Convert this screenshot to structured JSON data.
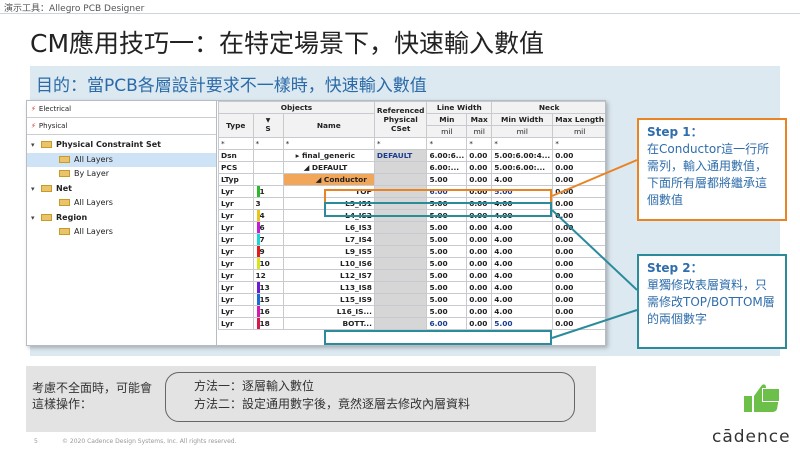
{
  "window": {
    "title": "演示工具：Allegro PCB Designer"
  },
  "slide": {
    "title": "CM應用技巧一：在特定場景下，快速輸入數值",
    "subtitle": "目的：當PCB各層設計要求不一樣時，快速輸入數值"
  },
  "tool": {
    "worksheet_tabs": [
      {
        "label": "Electrical",
        "icon": "electrical-icon"
      },
      {
        "label": "Physical",
        "icon": "physical-icon"
      }
    ],
    "tree": [
      {
        "label": "Physical Constraint Set",
        "level": 0,
        "expanded": true,
        "bold": true,
        "selected": false
      },
      {
        "label": "All Layers",
        "level": 1,
        "expanded": false,
        "bold": false,
        "selected": true
      },
      {
        "label": "By Layer",
        "level": 1,
        "expanded": false,
        "bold": false,
        "selected": false
      },
      {
        "label": "Net",
        "level": 0,
        "expanded": true,
        "bold": true,
        "selected": false
      },
      {
        "label": "All Layers",
        "level": 1,
        "expanded": false,
        "bold": false,
        "selected": false
      },
      {
        "label": "Region",
        "level": 0,
        "expanded": true,
        "bold": true,
        "selected": false
      },
      {
        "label": "All Layers",
        "level": 1,
        "expanded": false,
        "bold": false,
        "selected": false
      }
    ],
    "grid": {
      "group_headers": {
        "objects": "Objects",
        "referenced": "Referenced Physical CSet",
        "line_width": "Line Width",
        "neck": "Neck"
      },
      "col_headers": {
        "type": "Type",
        "s": "S",
        "name": "Name",
        "min": "Min",
        "max": "Max",
        "neck_min": "Min Width",
        "neck_max": "Max Length"
      },
      "units": {
        "lw_min": "mil",
        "lw_max": "mil",
        "neck_min": "mil",
        "neck_max": "mil"
      },
      "filter_row": {
        "type": "*",
        "s": "*",
        "name": "*",
        "ref": "*",
        "min": "*",
        "max": "*",
        "neck_min": "*",
        "neck_max": "*"
      },
      "rows": [
        {
          "type": "Dsn",
          "s": "",
          "name": "final_generic",
          "ref": "DEFAULT",
          "min": "6.00:6...",
          "max": "0.00",
          "neck_min": "5.00:6.00:4...",
          "neck_max": "0.00",
          "color": ""
        },
        {
          "type": "PCS",
          "s": "",
          "name": "DEFAULT",
          "ref": "",
          "min": "6.00:...",
          "max": "0.00",
          "neck_min": "5.00:6.00:...",
          "neck_max": "0.00",
          "color": ""
        },
        {
          "type": "LTyp",
          "s": "",
          "name": "Conductor",
          "ref": "",
          "min": "5.00",
          "max": "0.00",
          "neck_min": "4.00",
          "neck_max": "0.00",
          "color": ""
        },
        {
          "type": "Lyr",
          "s": "1",
          "name": "TOP",
          "ref": "",
          "min": "6.00",
          "max": "0.00",
          "neck_min": "5.00",
          "neck_max": "0.00",
          "color": "#2eb82e"
        },
        {
          "type": "Lyr",
          "s": "3",
          "name": "L3_IS1",
          "ref": "",
          "min": "5.00",
          "max": "0.00",
          "neck_min": "4.00",
          "neck_max": "0.00",
          "color": ""
        },
        {
          "type": "Lyr",
          "s": "4",
          "name": "L4_IS2",
          "ref": "",
          "min": "5.00",
          "max": "0.00",
          "neck_min": "4.00",
          "neck_max": "0.00",
          "color": "#e6c619"
        },
        {
          "type": "Lyr",
          "s": "6",
          "name": "L6_IS3",
          "ref": "",
          "min": "5.00",
          "max": "0.00",
          "neck_min": "4.00",
          "neck_max": "0.00",
          "color": "#c41bd6"
        },
        {
          "type": "Lyr",
          "s": "7",
          "name": "L7_IS4",
          "ref": "",
          "min": "5.00",
          "max": "0.00",
          "neck_min": "4.00",
          "neck_max": "0.00",
          "color": "#1bd6d6"
        },
        {
          "type": "Lyr",
          "s": "9",
          "name": "L9_IS5",
          "ref": "",
          "min": "5.00",
          "max": "0.00",
          "neck_min": "4.00",
          "neck_max": "0.00",
          "color": "#e61a1a"
        },
        {
          "type": "Lyr",
          "s": "10",
          "name": "L10_IS6",
          "ref": "",
          "min": "5.00",
          "max": "0.00",
          "neck_min": "4.00",
          "neck_max": "0.00",
          "color": "#d6e619"
        },
        {
          "type": "Lyr",
          "s": "12",
          "name": "L12_IS7",
          "ref": "",
          "min": "5.00",
          "max": "0.00",
          "neck_min": "4.00",
          "neck_max": "0.00",
          "color": ""
        },
        {
          "type": "Lyr",
          "s": "13",
          "name": "L13_IS8",
          "ref": "",
          "min": "5.00",
          "max": "0.00",
          "neck_min": "4.00",
          "neck_max": "0.00",
          "color": "#6a1bd6"
        },
        {
          "type": "Lyr",
          "s": "15",
          "name": "L15_IS9",
          "ref": "",
          "min": "5.00",
          "max": "0.00",
          "neck_min": "4.00",
          "neck_max": "0.00",
          "color": "#1b6ad6"
        },
        {
          "type": "Lyr",
          "s": "16",
          "name": "L16_IS...",
          "ref": "",
          "min": "5.00",
          "max": "0.00",
          "neck_min": "4.00",
          "neck_max": "0.00",
          "color": "#d61bb0"
        },
        {
          "type": "Lyr",
          "s": "18",
          "name": "BOTT...",
          "ref": "",
          "min": "6.00",
          "max": "0.00",
          "neck_min": "5.00",
          "neck_max": "0.00",
          "color": "#d61b4a"
        }
      ]
    }
  },
  "callouts": {
    "step1": {
      "heading": "Step 1：",
      "body": "在Conductor這一行所需列，輸入通用數值，下面所有層都將繼承這個數值"
    },
    "step2": {
      "heading": "Step 2：",
      "body": "單獨修改表層資料，只需修改TOP/BOTTOM層的兩個數字"
    }
  },
  "bottom": {
    "question": "考慮不全面時，可能會這樣操作：",
    "method1": "方法一：逐層輸入數位",
    "method2": "方法二：設定通用數字後，竟然逐層去修改內層資料"
  },
  "footer": {
    "page": "5",
    "copyright": "© 2020 Cadence Design Systems, Inc. All rights reserved.",
    "logo": "cādence"
  },
  "colors": {
    "accent_orange": "#e88424",
    "accent_teal": "#2b8b9b",
    "title_blue": "#2a6aa8",
    "band": "#dde9f1"
  }
}
